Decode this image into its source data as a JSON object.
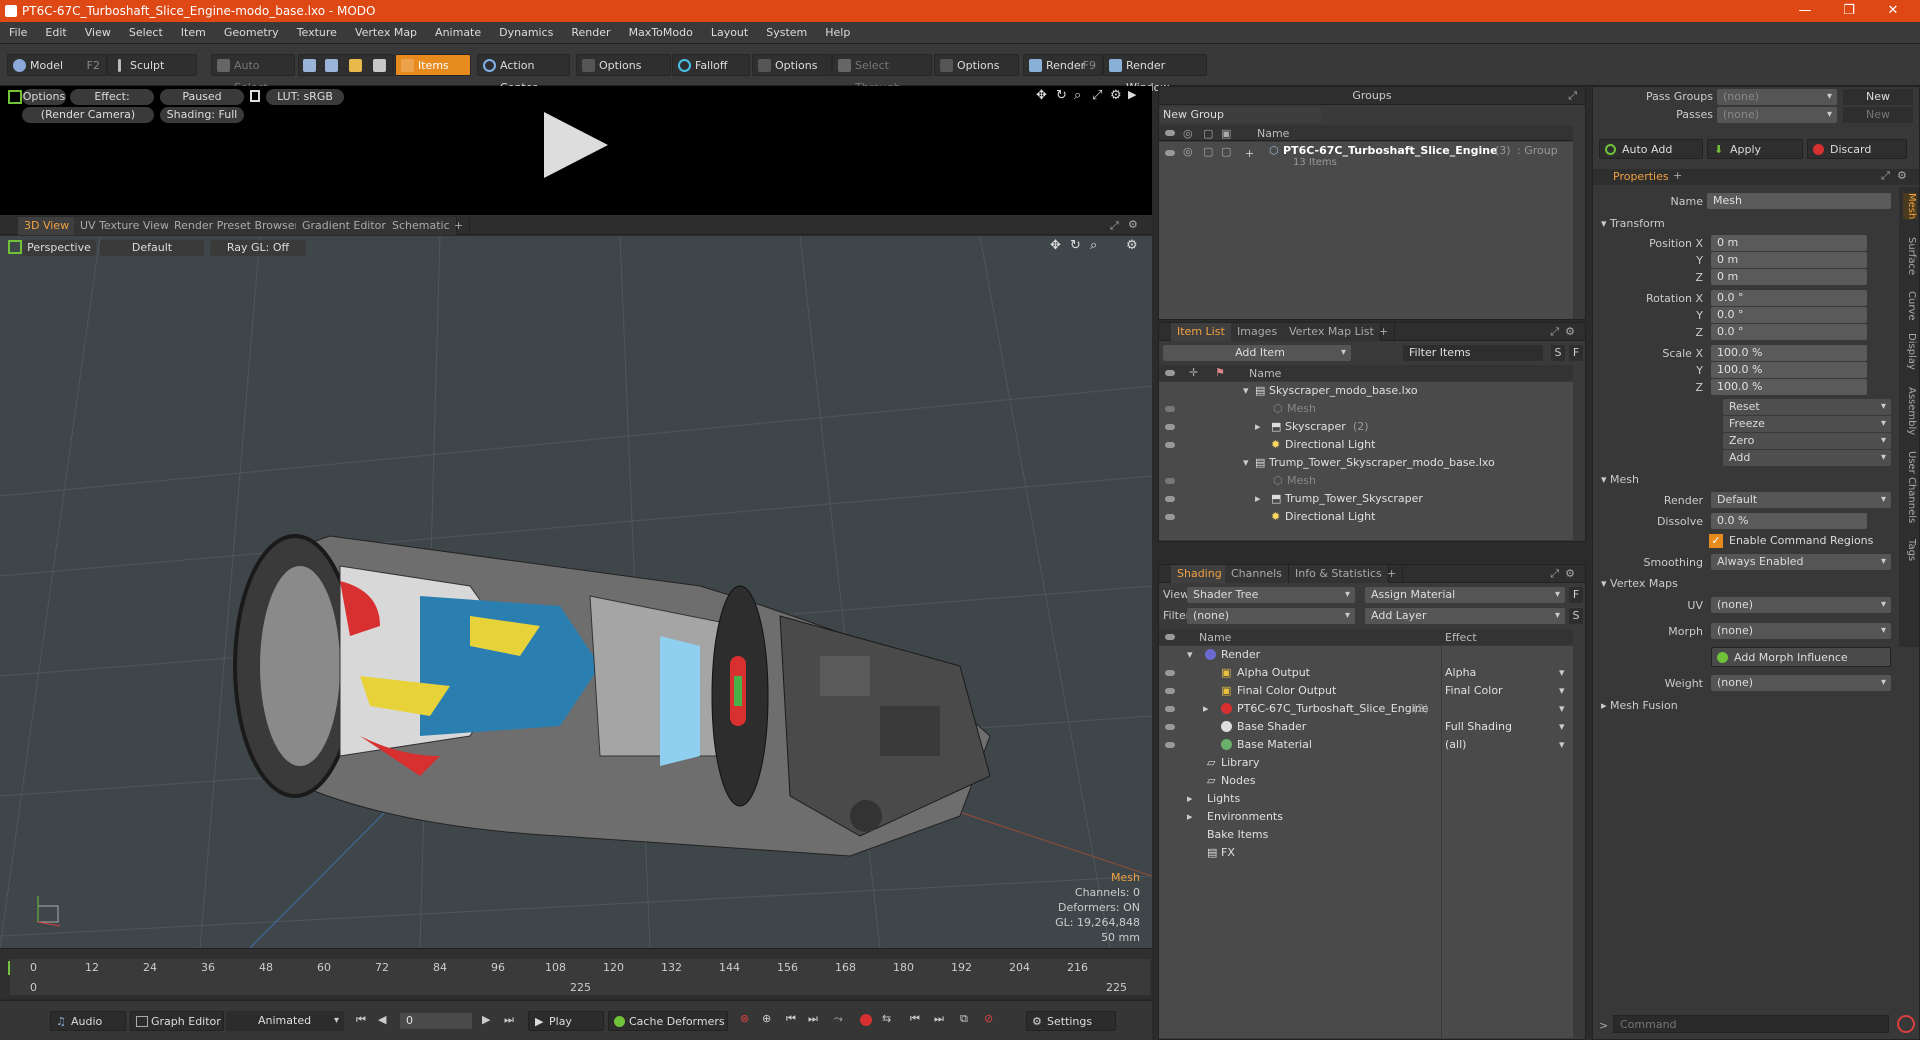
{
  "window": {
    "title": "PT6C-67C_Turboshaft_Slice_Engine-modo_base.lxo - MODO",
    "minimize": "—",
    "maximize": "❐",
    "close": "✕"
  },
  "menu": [
    "File",
    "Edit",
    "View",
    "Select",
    "Item",
    "Geometry",
    "Texture",
    "Vertex Map",
    "Animate",
    "Dynamics",
    "Render",
    "MaxToModo",
    "Layout",
    "System",
    "Help"
  ],
  "toolbar": {
    "model": "Model",
    "model_key": "F2",
    "sculpt": "Sculpt",
    "auto_select": "Auto Select",
    "items": "Items",
    "action_center": "Action Center",
    "options1": "Options",
    "falloff": "Falloff",
    "options2": "Options",
    "select_through": "Select Through",
    "options3": "Options",
    "render": "Render",
    "render_key": "F9",
    "render_window": "Render Window"
  },
  "preview": {
    "options": "Options",
    "effect": "Effect: (Shadi...",
    "paused": "Paused",
    "lut": "LUT: sRGB",
    "camera": "(Render Camera)",
    "shading": "Shading: Full"
  },
  "viewport_tabs": [
    "3D View",
    "UV Texture View",
    "Render Preset Browser",
    "Gradient Editor",
    "Schematic",
    "+"
  ],
  "viewport": {
    "perspective": "Perspective",
    "default": "Default",
    "raygl": "Ray GL: Off",
    "hud": {
      "type": "Mesh",
      "channels": "Channels: 0",
      "deformers": "Deformers: ON",
      "gl": "GL: 19,264,848",
      "focal": "50 mm"
    }
  },
  "timeline": {
    "ticks": [
      "0",
      "12",
      "24",
      "36",
      "48",
      "60",
      "72",
      "84",
      "96",
      "108",
      "120",
      "132",
      "144",
      "156",
      "168",
      "180",
      "192",
      "204",
      "216"
    ],
    "start": "0",
    "mid": "225",
    "end": "225"
  },
  "bottom": {
    "audio": "Audio",
    "graph_editor": "Graph Editor",
    "animated": "Animated",
    "frame": "0",
    "play": "Play",
    "cache": "Cache Deformers",
    "settings": "Settings"
  },
  "groups": {
    "title": "Groups",
    "new_group": "New Group",
    "col_name": "Name",
    "item_name": "PT6C-67C_Turboshaft_Slice_Engine",
    "item_count": "(3)",
    "item_type": ": Group",
    "item_sub": "13 Items"
  },
  "itemlist": {
    "tabs": [
      "Item List",
      "Images",
      "Vertex Map List",
      "+"
    ],
    "add_item": "Add Item",
    "filter": "Filter Items",
    "s": "S",
    "f": "F",
    "col_name": "Name",
    "rows": [
      {
        "name": "Skyscraper_modo_base.lxo",
        "indent": 0,
        "dim": false
      },
      {
        "name": "Mesh",
        "indent": 2,
        "dim": true
      },
      {
        "name": "Skyscraper",
        "extra": "(2)",
        "indent": 1,
        "dim": false
      },
      {
        "name": "Directional Light",
        "indent": 1,
        "dim": false
      },
      {
        "name": "Trump_Tower_Skyscraper_modo_base.lxo",
        "indent": 0,
        "dim": false
      },
      {
        "name": "Mesh",
        "indent": 2,
        "dim": true
      },
      {
        "name": "Trump_Tower_Skyscraper",
        "indent": 1,
        "dim": false
      },
      {
        "name": "Directional Light",
        "indent": 1,
        "dim": false
      }
    ]
  },
  "shading": {
    "tabs": [
      "Shading",
      "Channels",
      "Info & Statistics",
      "+"
    ],
    "view_label": "View",
    "view_value": "Shader Tree",
    "assign": "Assign Material",
    "f": "F",
    "filter_label": "Filter",
    "filter_value": "(none)",
    "add_layer": "Add Layer",
    "s": "S",
    "col_name": "Name",
    "col_effect": "Effect",
    "rows": [
      {
        "name": "Render",
        "effect": ""
      },
      {
        "name": "Alpha Output",
        "effect": "Alpha"
      },
      {
        "name": "Final Color Output",
        "effect": "Final Color"
      },
      {
        "name": "PT6C-67C_Turboshaft_Slice_Engine",
        "extra": "(2)",
        "effect": ""
      },
      {
        "name": "Base Shader",
        "effect": "Full Shading"
      },
      {
        "name": "Base Material",
        "effect": "(all)"
      },
      {
        "name": "Library",
        "effect": ""
      },
      {
        "name": "Nodes",
        "effect": ""
      },
      {
        "name": "Lights",
        "effect": ""
      },
      {
        "name": "Environments",
        "effect": ""
      },
      {
        "name": "Bake Items",
        "effect": ""
      },
      {
        "name": "FX",
        "effect": ""
      }
    ]
  },
  "passes": {
    "pass_groups": "Pass Groups",
    "passes": "Passes",
    "none1": "(none)",
    "none2": "(none)",
    "new1": "New",
    "new2": "New",
    "auto_add": "Auto Add",
    "apply": "Apply",
    "discard": "Discard"
  },
  "properties": {
    "tab": "Properties",
    "plus": "+",
    "name_label": "Name",
    "name_value": "Mesh",
    "transform": "Transform",
    "pos_label": "Position X",
    "pos": [
      "0 m",
      "0 m",
      "0 m"
    ],
    "rot_label": "Rotation X",
    "rot": [
      "0.0 °",
      "0.0 °",
      "0.0 °"
    ],
    "scale_label": "Scale X",
    "scale": [
      "100.0 %",
      "100.0 %",
      "100.0 %"
    ],
    "y": "Y",
    "z": "Z",
    "reset": "Reset",
    "freeze": "Freeze",
    "zero": "Zero",
    "add": "Add",
    "mesh": "Mesh",
    "render_label": "Render",
    "render_value": "Default",
    "dissolve_label": "Dissolve",
    "dissolve_value": "0.0 %",
    "enable_cmd": "Enable Command Regions",
    "smoothing_label": "Smoothing",
    "smoothing_value": "Always Enabled",
    "vertex_maps": "Vertex Maps",
    "uv_label": "UV",
    "uv_value": "(none)",
    "morph_label": "Morph",
    "morph_value": "(none)",
    "add_morph": "Add Morph Influence",
    "weight_label": "Weight",
    "weight_value": "(none)",
    "mesh_fusion": "Mesh Fusion",
    "side_tabs": [
      "Mesh",
      "Surface",
      "Curve",
      "Display",
      "Assembly",
      "User Channels",
      "Tags"
    ]
  },
  "command": {
    "placeholder": "Command"
  }
}
